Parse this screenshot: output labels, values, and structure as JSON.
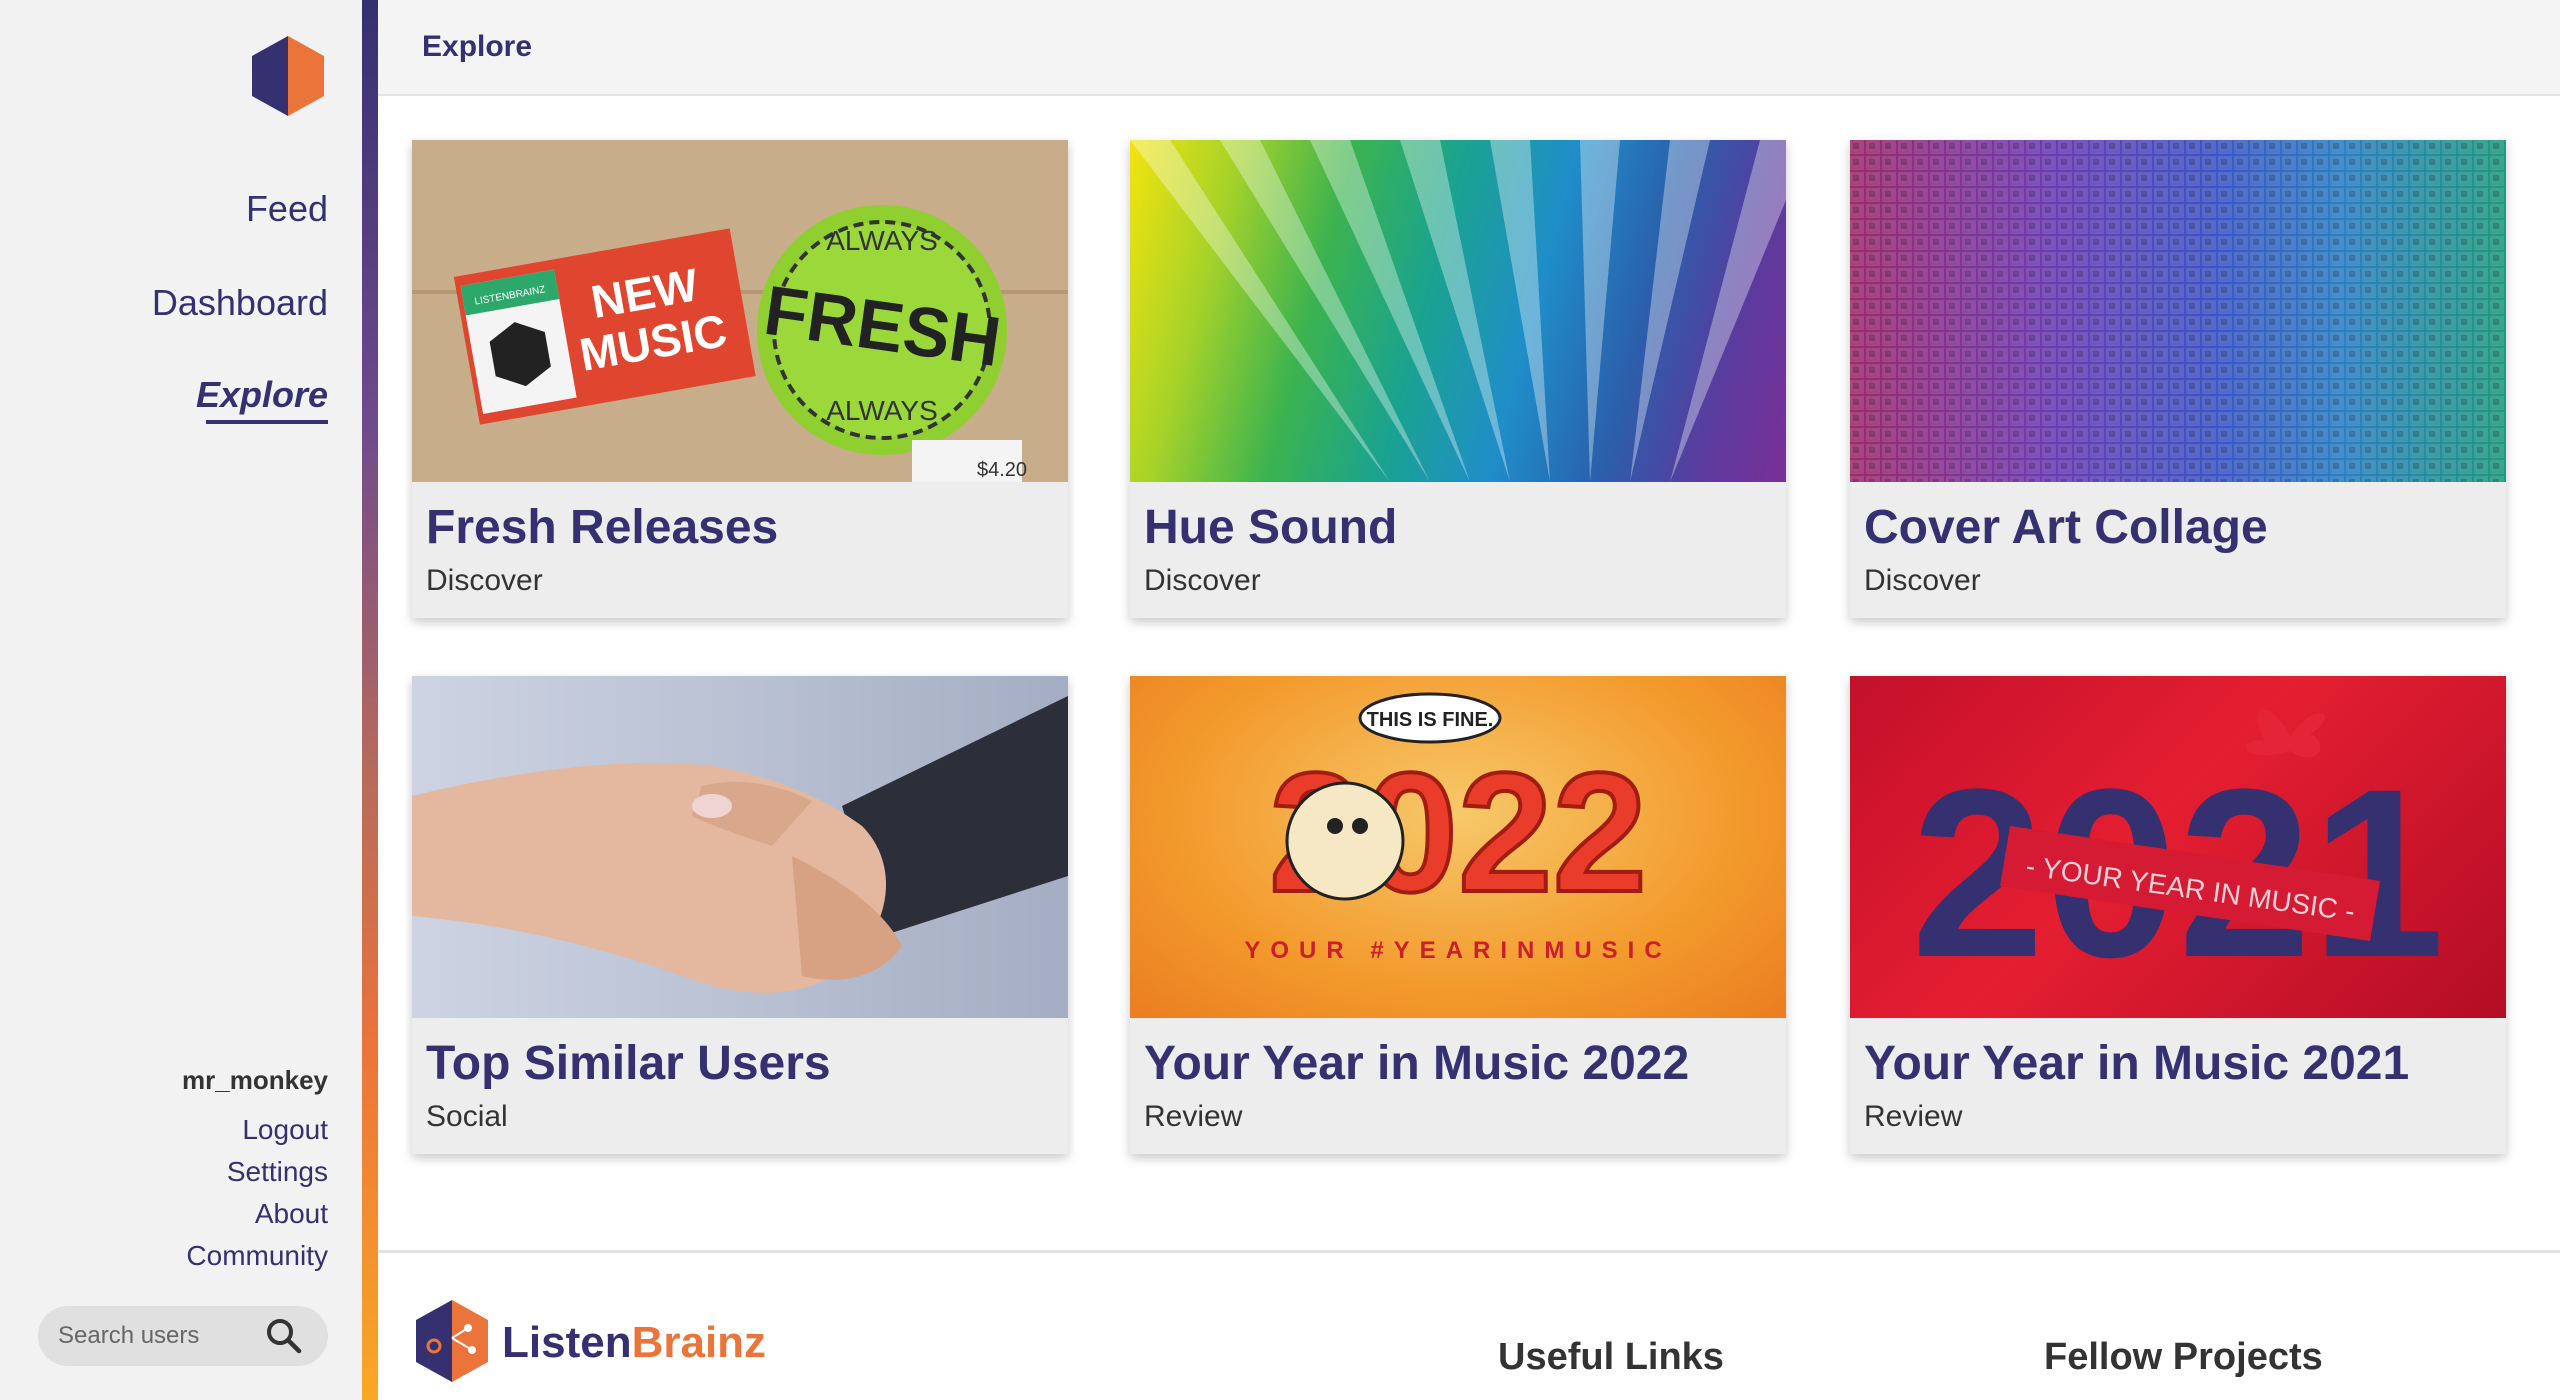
{
  "sidebar": {
    "nav": {
      "feed": "Feed",
      "dashboard": "Dashboard",
      "explore": "Explore"
    },
    "user": {
      "name": "mr_monkey",
      "logout": "Logout",
      "settings": "Settings",
      "about": "About",
      "community": "Community"
    },
    "search": {
      "placeholder": "Search users"
    }
  },
  "header": {
    "title": "Explore"
  },
  "cards": [
    {
      "title": "Fresh Releases",
      "category": "Discover"
    },
    {
      "title": "Hue Sound",
      "category": "Discover"
    },
    {
      "title": "Cover Art Collage",
      "category": "Discover"
    },
    {
      "title": "Top Similar Users",
      "category": "Social"
    },
    {
      "title": "Your Year in Music 2022",
      "category": "Review"
    },
    {
      "title": "Your Year in Music 2021",
      "category": "Review"
    }
  ],
  "card_art": {
    "fresh": {
      "sticker_new": [
        "NEW",
        "MUSIC"
      ],
      "sticker_fresh": "FRESH",
      "sticker_ring_top": "ALWAYS",
      "sticker_ring_bottom": "ALWAYS",
      "logo_small": "LISTENBRAINZ",
      "price": "$4.20"
    },
    "yim22": {
      "bubble": "THIS IS FINE.",
      "year": "2022",
      "tagline": "YOUR #YEARINMUSIC"
    },
    "yim21": {
      "year": "2021",
      "ribbon": "- YOUR YEAR IN MUSIC -"
    }
  },
  "footer": {
    "brand_part1": "Listen",
    "brand_part2": "Brainz",
    "useful_links": "Useful Links",
    "fellow_projects": "Fellow Projects"
  },
  "colors": {
    "brand_purple": "#353070",
    "brand_orange": "#eb743b",
    "sidebar_bg": "#f2f2f2",
    "card_bg": "#ededed"
  }
}
